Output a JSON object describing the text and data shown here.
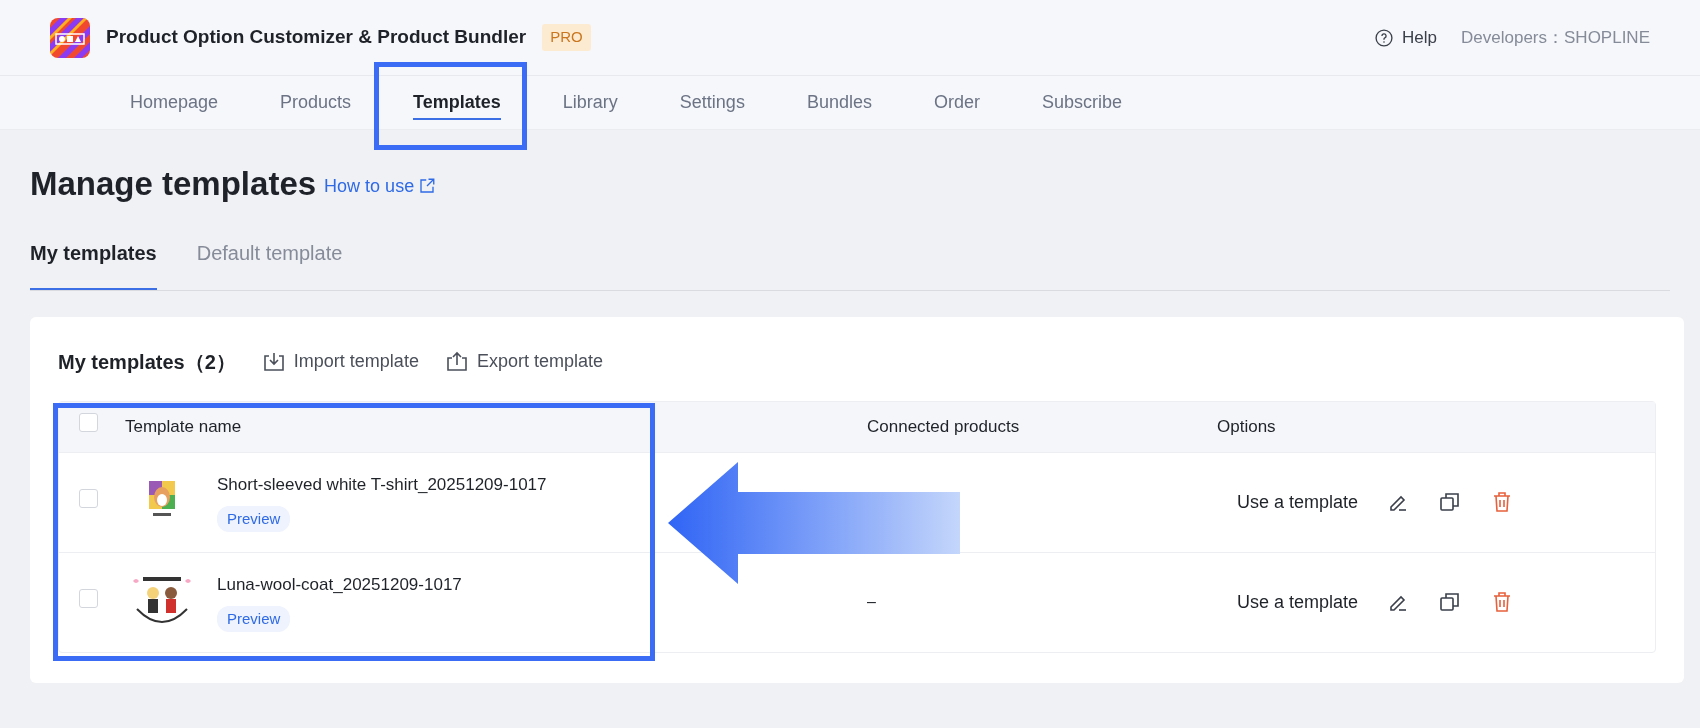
{
  "app": {
    "title": "Product Option Customizer & Product Bundler",
    "badge": "PRO",
    "help": "Help",
    "developer": "Developers：SHOPLINE"
  },
  "nav": [
    {
      "label": "Homepage",
      "selected": false
    },
    {
      "label": "Products",
      "selected": false
    },
    {
      "label": "Templates",
      "selected": true
    },
    {
      "label": "Library",
      "selected": false
    },
    {
      "label": "Settings",
      "selected": false
    },
    {
      "label": "Bundles",
      "selected": false
    },
    {
      "label": "Order",
      "selected": false
    },
    {
      "label": "Subscribe",
      "selected": false
    }
  ],
  "page": {
    "title": "Manage templates",
    "help_link": "How to use"
  },
  "tabs": [
    {
      "label": "My templates",
      "selected": true
    },
    {
      "label": "Default template",
      "selected": false
    }
  ],
  "card": {
    "title": "My templates（2）",
    "actions": [
      {
        "kind": "import",
        "label": "Import template"
      },
      {
        "kind": "export",
        "label": "Export template"
      }
    ]
  },
  "table": {
    "columns": [
      "Template name",
      "Connected products",
      "Options"
    ],
    "select_all": {
      "checked": false
    },
    "rows": [
      {
        "checked": false,
        "name": "Short-sleeved white T-shirt_20251209-1017",
        "preview": "Preview",
        "use": "Use a template"
      },
      {
        "checked": false,
        "name": "Luna-wool-coat_20251209-1017",
        "preview": "Preview",
        "connected": "–",
        "use": "Use a template"
      }
    ]
  },
  "annotations": [
    {
      "kind": "frame"
    },
    {
      "kind": "frame"
    },
    {
      "kind": "arrow"
    }
  ]
}
